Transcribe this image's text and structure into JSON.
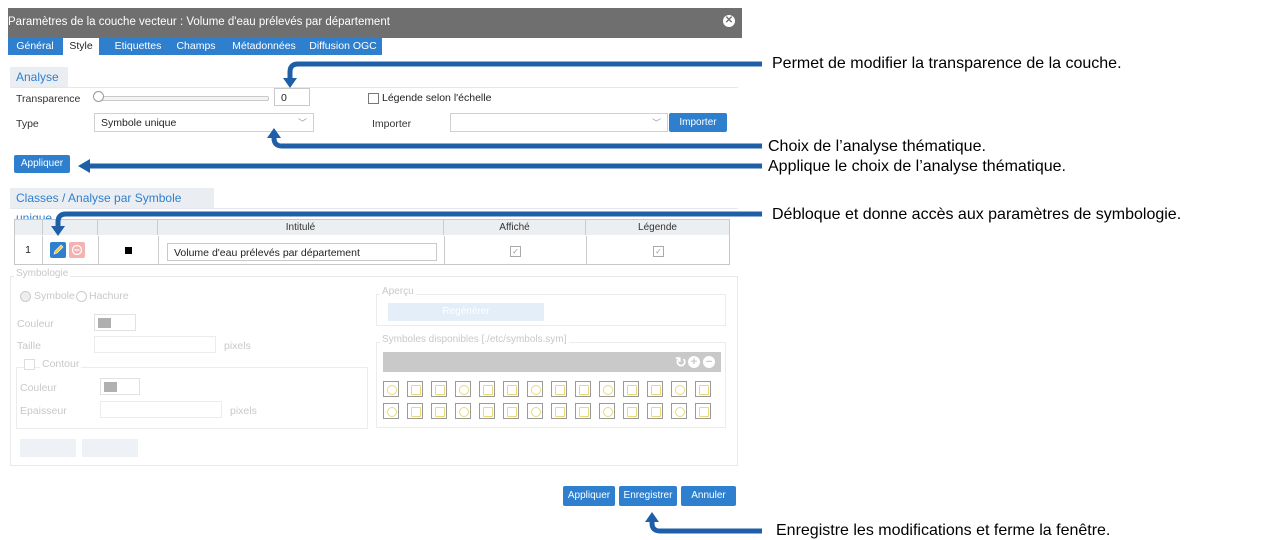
{
  "window": {
    "title": "Paramètres de la couche vecteur : Volume d'eau prélevés par département"
  },
  "tabs": [
    {
      "label": "Général"
    },
    {
      "label": "Style"
    },
    {
      "label": "Etiquettes"
    },
    {
      "label": "Champs"
    },
    {
      "label": "Métadonnées"
    },
    {
      "label": "Diffusion OGC"
    }
  ],
  "analyse": {
    "heading": "Analyse",
    "transparence_label": "Transparence",
    "transparence_value": "0",
    "legend_scale_label": "Légende selon l'échelle",
    "type_label": "Type",
    "type_value": "Symbole unique",
    "importer_label": "Importer",
    "importer_button": "Importer",
    "appliquer_button": "Appliquer"
  },
  "classes": {
    "heading": "Classes / Analyse par Symbole unique",
    "columns": [
      "Intitulé",
      "Affiché",
      "Légende"
    ],
    "rows": [
      {
        "index": "1",
        "label": "Volume d'eau prélevés par département"
      }
    ]
  },
  "symbologie": {
    "heading": "Symbologie",
    "radio_symbole": "Symbole",
    "radio_hachure": "Hachure",
    "couleur_label": "Couleur",
    "taille_label": "Taille",
    "pixels_unit": "pixels",
    "contour_label": "Contour",
    "contour_couleur_label": "Couleur",
    "epaisseur_label": "Epaisseur",
    "apercu_label": "Aperçu",
    "regenerer_button": "Regénérer",
    "symbols_label": "Symboles disponibles [./etc/symbols.sym]"
  },
  "footer": {
    "appliquer": "Appliquer",
    "enregistrer": "Enregistrer",
    "annuler": "Annuler"
  },
  "annotations": {
    "transparence": "Permet de modifier la transparence de la couche.",
    "analyse": "Choix de l’analyse thématique.",
    "appliquer": "Applique le choix de l’analyse thématique.",
    "edit": "Débloque et donne accès aux paramètres de symbologie.",
    "save": "Enregistre les modifications et ferme la fenêtre."
  },
  "colors": {
    "accent": "#2f7fcf",
    "arrow": "#1f5fa8",
    "titlebar": "#6f6f6f"
  }
}
